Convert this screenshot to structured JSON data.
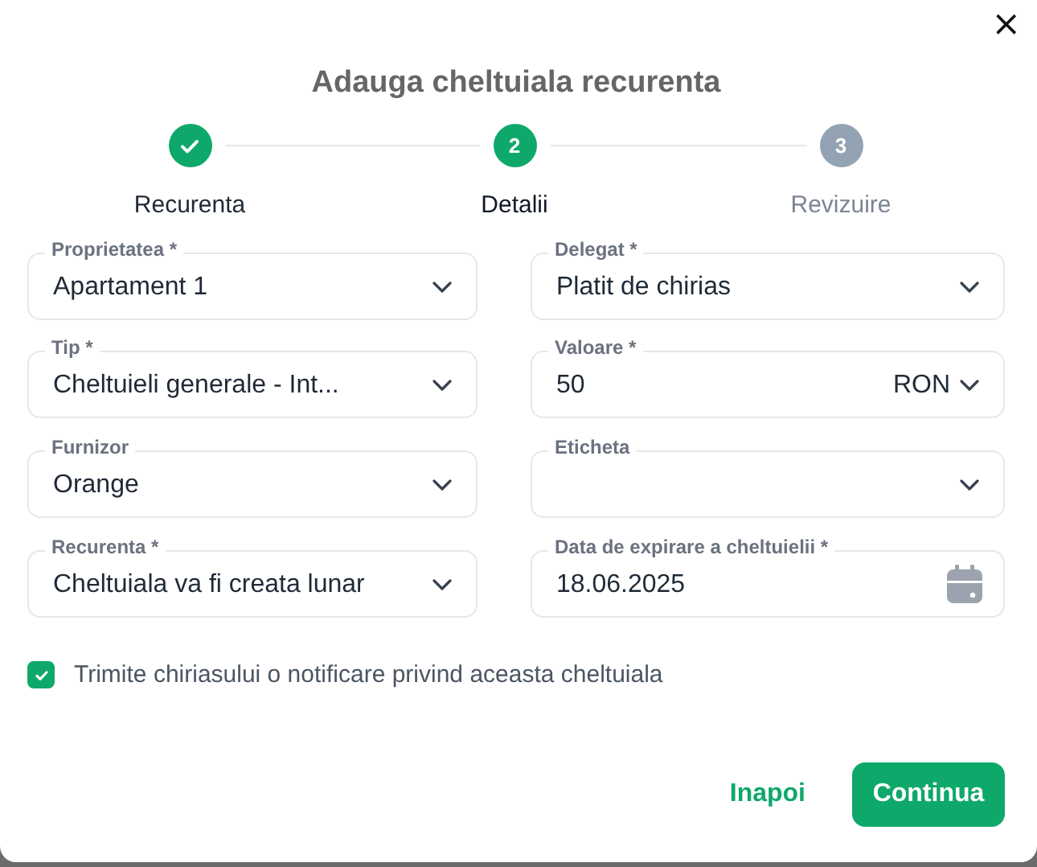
{
  "dialog": {
    "title": "Adauga cheltuiala recurenta",
    "close": "×"
  },
  "steps": [
    {
      "label": "Recurenta",
      "completed": true,
      "selected": false
    },
    {
      "number": "2",
      "label": "Detalii",
      "completed": false,
      "selected": true
    },
    {
      "number": "3",
      "label": "Revizuire",
      "completed": false,
      "selected": false
    }
  ],
  "fields": [
    {
      "label": "Proprietatea *",
      "value": "Apartament 1",
      "kind": "select"
    },
    {
      "label": "Delegat *",
      "value": "Platit de chirias",
      "kind": "select"
    },
    {
      "label": "Tip *",
      "value": "Cheltuieli generale - Int...",
      "kind": "select"
    },
    {
      "label": "Valoare *",
      "value": "50",
      "currency": "RON",
      "kind": "amount"
    },
    {
      "label": "Furnizor",
      "value": "Orange",
      "kind": "select"
    },
    {
      "label": "Eticheta",
      "kind": "select"
    },
    {
      "label": "Recurenta *",
      "value": "Cheltuiala va fi creata lunar",
      "kind": "select"
    },
    {
      "label": "Data de expirare a cheltuielii *",
      "value": "18.06.2025",
      "kind": "date"
    }
  ],
  "notify": {
    "label": "Trimite chiriasului o notificare privind aceasta cheltuiala",
    "checked": true
  },
  "buttons": [
    {
      "label": "Inapoi",
      "kind": "text"
    },
    {
      "label": "Continua",
      "kind": "primary"
    }
  ]
}
